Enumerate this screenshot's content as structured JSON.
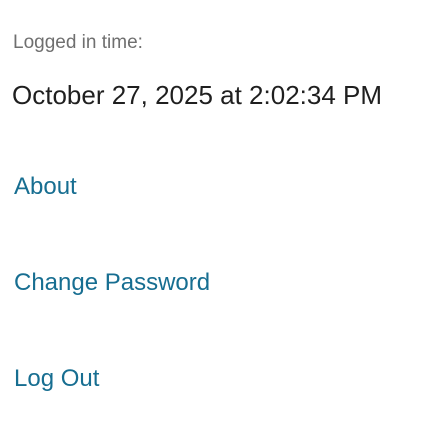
{
  "session": {
    "logged_in_label": "Logged in time:",
    "logged_in_value": "October 27, 2025 at 2:02:34 PM"
  },
  "menu": {
    "items": [
      {
        "label": "About"
      },
      {
        "label": "Change Password"
      },
      {
        "label": "Log Out"
      }
    ]
  },
  "colors": {
    "link": "#176e91",
    "label": "#6f6f6f",
    "text": "#1f1f1f"
  }
}
